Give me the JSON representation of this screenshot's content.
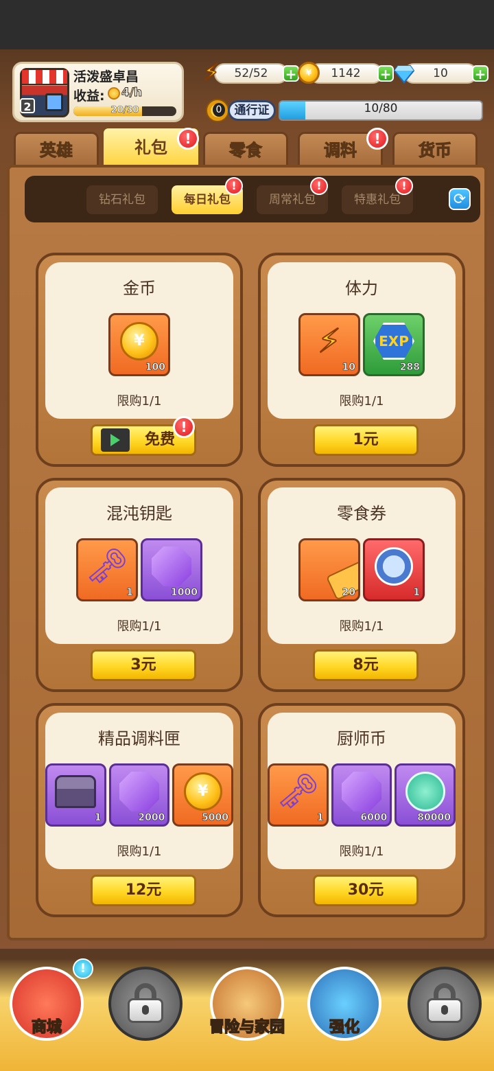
{
  "player": {
    "name": "活泼盛卓昌",
    "level": "2",
    "income_label": "收益:",
    "income_value": "4/h",
    "exp_text": "20/30",
    "exp_progress": 0.667
  },
  "resources": {
    "stamina": "52/52",
    "coins": "1142",
    "diamonds": "10",
    "plus": "+"
  },
  "pass": {
    "count": "0",
    "label": "通行证",
    "progress_text": "10/80",
    "progress": 0.125
  },
  "category_tabs": [
    {
      "label": "英雄"
    },
    {
      "label": "礼包",
      "alert": "!"
    },
    {
      "label": "零食"
    },
    {
      "label": "调料",
      "alert": "!"
    },
    {
      "label": "货币"
    }
  ],
  "sub_tabs": [
    {
      "label": "钻石礼包"
    },
    {
      "label": "每日礼包",
      "alert": "!"
    },
    {
      "label": "周常礼包",
      "alert": "!"
    },
    {
      "label": "特惠礼包",
      "alert": "!"
    }
  ],
  "refresh_icon": "refresh-icon",
  "gifts": [
    {
      "title": "金币",
      "limit": "限购1/1",
      "price": "免费",
      "alert": "!",
      "items": [
        {
          "icon": "coin",
          "qty": "100",
          "glyph": "¥"
        }
      ]
    },
    {
      "title": "体力",
      "limit": "限购1/1",
      "price": "1元",
      "items": [
        {
          "icon": "stamina",
          "qty": "10",
          "glyph": "⚡"
        },
        {
          "icon": "exp",
          "qty": "288",
          "glyph": "EXP"
        }
      ]
    },
    {
      "title": "混沌钥匙",
      "limit": "限购1/1",
      "price": "3元",
      "items": [
        {
          "icon": "key",
          "qty": "1",
          "glyph": "🗝"
        },
        {
          "icon": "gem",
          "qty": "1000"
        }
      ]
    },
    {
      "title": "零食券",
      "limit": "限购1/1",
      "price": "8元",
      "items": [
        {
          "icon": "ticket",
          "qty": "20"
        },
        {
          "icon": "snack-badge",
          "qty": "1"
        }
      ]
    },
    {
      "title": "精品调料匣",
      "limit": "限购1/1",
      "price": "12元",
      "items": [
        {
          "icon": "chest",
          "qty": "1"
        },
        {
          "icon": "gem",
          "qty": "2000"
        },
        {
          "icon": "coin",
          "qty": "5000",
          "glyph": "¥"
        }
      ]
    },
    {
      "title": "厨师币",
      "limit": "限购1/1",
      "price": "30元",
      "items": [
        {
          "icon": "key",
          "qty": "1",
          "glyph": "🗝"
        },
        {
          "icon": "gem",
          "qty": "6000"
        },
        {
          "icon": "chef-coin",
          "qty": "80000"
        }
      ]
    }
  ],
  "bottom_nav": [
    {
      "label": "商城",
      "alert": "!"
    },
    {
      "label": "",
      "locked": true
    },
    {
      "label": "冒险与家园"
    },
    {
      "label": "强化"
    },
    {
      "label": "",
      "locked": true
    }
  ],
  "colors": {
    "accent": "#ffd825",
    "alert": "#e3171b",
    "panel": "#b87a44",
    "card_inner": "#f8efdd"
  }
}
